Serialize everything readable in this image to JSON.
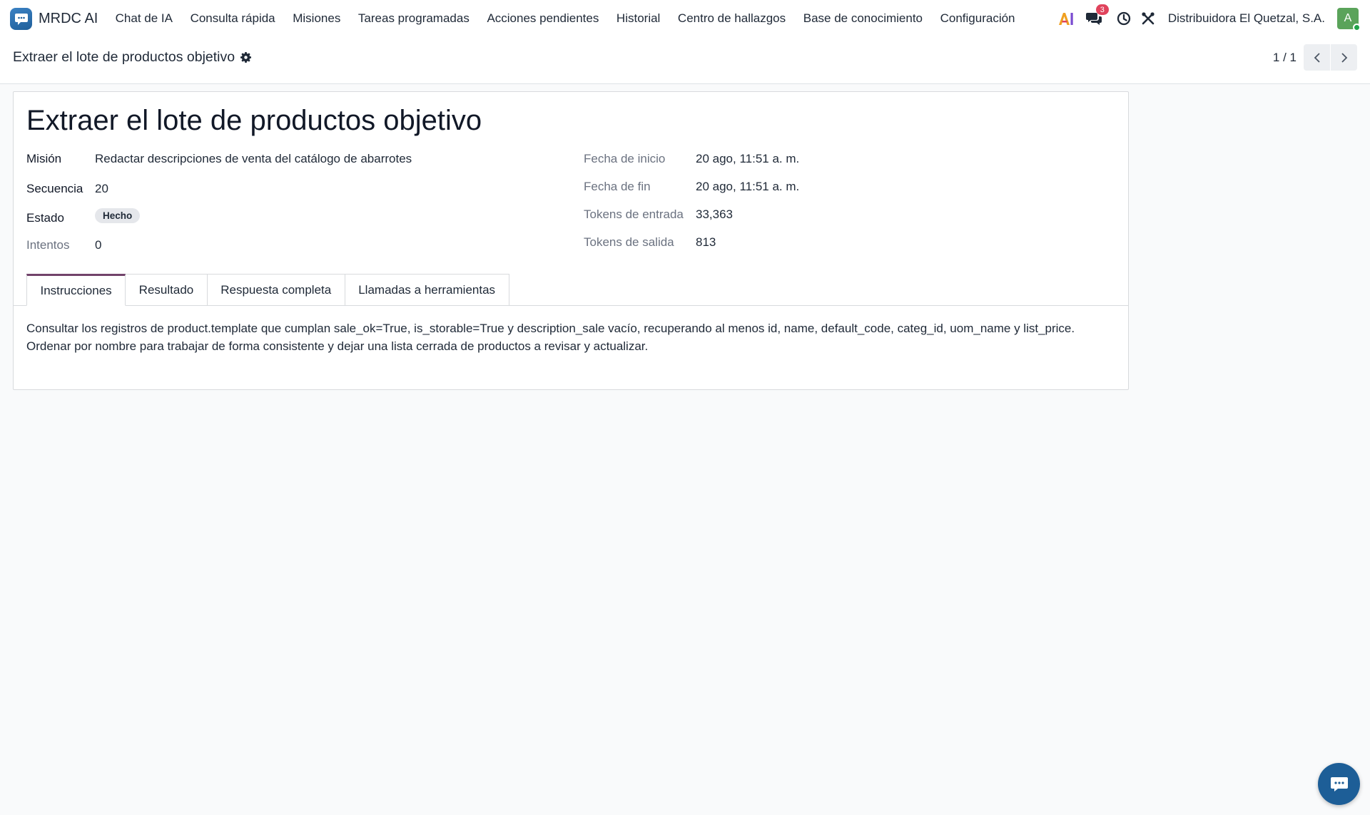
{
  "navbar": {
    "brand_name": "MRDC AI",
    "menu": [
      {
        "label": "Chat de IA"
      },
      {
        "label": "Consulta rápida"
      },
      {
        "label": "Misiones"
      },
      {
        "label": "Tareas programadas"
      },
      {
        "label": "Acciones pendientes"
      },
      {
        "label": "Historial"
      },
      {
        "label": "Centro de hallazgos"
      },
      {
        "label": "Base de conocimiento"
      },
      {
        "label": "Configuración"
      }
    ],
    "messages_badge": "3",
    "company": "Distribuidora El Quetzal, S.A.",
    "avatar_initial": "A"
  },
  "control_panel": {
    "breadcrumb": "Extraer el lote de productos objetivo",
    "pager_value": "1 / 1"
  },
  "record": {
    "title": "Extraer el lote de productos objetivo",
    "left_fields": {
      "mision": {
        "label": "Misión",
        "value": "Redactar descripciones de venta del catálogo de abarrotes"
      },
      "secuencia": {
        "label": "Secuencia",
        "value": "20"
      },
      "estado": {
        "label": "Estado",
        "value": "Hecho"
      },
      "intentos": {
        "label": "Intentos",
        "value": "0"
      }
    },
    "right_fields": {
      "fecha_inicio": {
        "label": "Fecha de inicio",
        "value": "20 ago, 11:51 a. m."
      },
      "fecha_fin": {
        "label": "Fecha de fin",
        "value": "20 ago, 11:51 a. m."
      },
      "tokens_entrada": {
        "label": "Tokens de entrada",
        "value": "33,363"
      },
      "tokens_salida": {
        "label": "Tokens de salida",
        "value": "813"
      }
    }
  },
  "tabs": [
    {
      "label": "Instrucciones",
      "active": true
    },
    {
      "label": "Resultado",
      "active": false
    },
    {
      "label": "Respuesta completa",
      "active": false
    },
    {
      "label": "Llamadas a herramientas",
      "active": false
    }
  ],
  "instructions_text": "Consultar los registros de product.template que cumplan sale_ok=True, is_storable=True y description_sale vacío, recuperando al menos id, name, default_code, categ_id, uom_name y list_price. Ordenar por nombre para trabajar de forma consistente y dejar una lista cerrada de productos a revisar y actualizar.",
  "icons": {
    "brand": "chat-bubble-logo-icon",
    "ai_apps": "ai-letter-icon",
    "messages": "chat-bubbles-icon",
    "activities": "clock-icon",
    "debug": "crossed-tools-icon",
    "gear": "gear-icon",
    "prev": "chevron-left-icon",
    "next": "chevron-right-icon",
    "fab": "chat-bubble-icon"
  },
  "colors": {
    "brand_blue": "#1f5f9a",
    "active_tab_accent": "#71436a",
    "badge_red": "#e0435c",
    "avatar_green": "#5aa35a",
    "page_bg": "#f9fafb"
  }
}
